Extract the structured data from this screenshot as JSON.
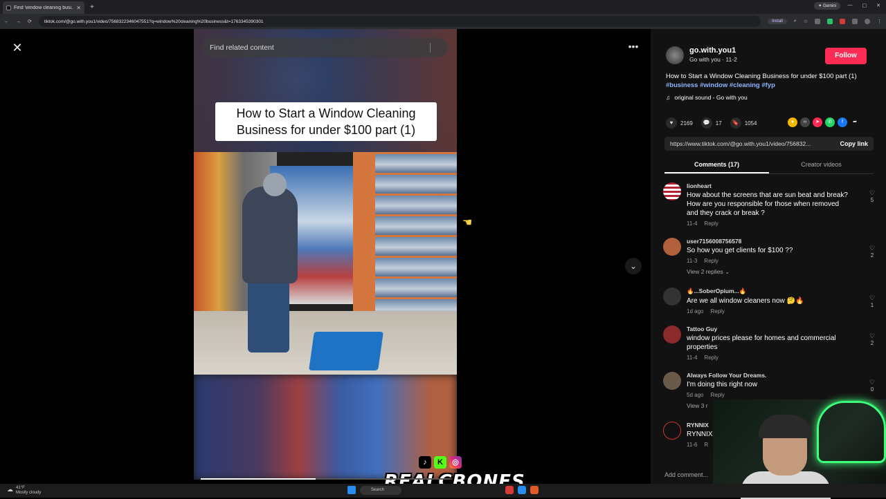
{
  "browser": {
    "tab_title": "Find 'window cleaning busi...",
    "url": "tiktok.com/@go.with.you1/video/7568322346047551?q=window%20cleaning%20business&t=1763345390301",
    "install_label": "Install",
    "gemini_label": "Gemini"
  },
  "video": {
    "search_placeholder": "Find related content",
    "caption": "How to Start a Window Cleaning Business for under $100 part (1)",
    "progress_fraction": 0.46
  },
  "post": {
    "username": "go.with.you1",
    "subline": "Go with you · 11-2",
    "follow_label": "Follow",
    "description": "How to Start a Window Cleaning Business for under $100 part (1)",
    "hashtags": [
      "#business",
      "#window",
      "#cleaning",
      "#fyp"
    ],
    "sound": "original sound - Go with you",
    "likes": "2169",
    "comments_count": "17",
    "saves": "1054",
    "link": "https://www.tiktok.com/@go.with.you1/video/756832...",
    "copy_label": "Copy link",
    "tab_comments": "Comments (17)",
    "tab_creator": "Creator videos",
    "add_comment": "Add comment..."
  },
  "comments": [
    {
      "user": "lionheart",
      "text": "How about the screens that are sun beat and break? How are you responsible for those when removed and they crack or break ?",
      "date": "11-4",
      "reply": "Reply",
      "likes": "5",
      "avatar_color": "#b03a3a"
    },
    {
      "user": "user7156008756578",
      "text": "So how you get clients for $100 ??",
      "date": "11-3",
      "reply": "Reply",
      "likes": "2",
      "replies": "View 2 replies",
      "avatar_color": "#b0603a"
    },
    {
      "user": "🔥...SoberOpium...🔥",
      "text": "Are we all window cleaners now 🤔🔥",
      "date": "1d ago",
      "reply": "Reply",
      "likes": "1",
      "avatar_color": "#333333"
    },
    {
      "user": "Tattoo Guy",
      "text": "window prices please for homes and commercial properties",
      "date": "11-4",
      "reply": "Reply",
      "likes": "2",
      "avatar_color": "#8a2a2a"
    },
    {
      "user": "Always Follow Your Dreams.",
      "text": "I'm doing this right now",
      "date": "5d ago",
      "reply": "Reply",
      "likes": "0",
      "replies": "View 3 r",
      "avatar_color": "#6a5a4a"
    },
    {
      "user": "RYNNIX",
      "text": "RYNNIX",
      "date": "11-6",
      "reply": "R",
      "likes": "",
      "avatar_color": "#111111"
    }
  ],
  "overlay": {
    "brand": "REALCBONES"
  },
  "taskbar": {
    "temp": "41°F",
    "weather": "Mostly cloudy",
    "search": "Search"
  }
}
